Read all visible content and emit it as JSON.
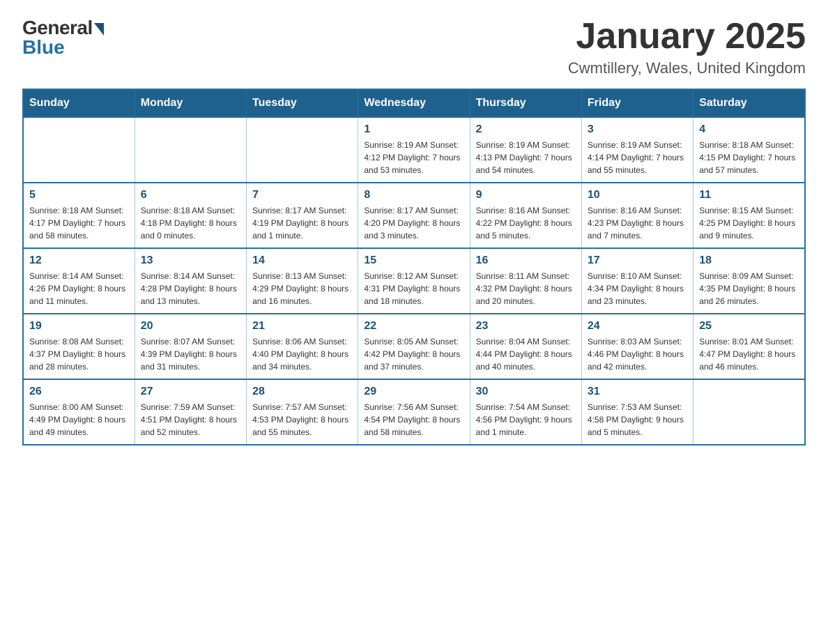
{
  "header": {
    "logo": {
      "general": "General",
      "blue": "Blue"
    },
    "title": "January 2025",
    "location": "Cwmtillery, Wales, United Kingdom"
  },
  "days_of_week": [
    "Sunday",
    "Monday",
    "Tuesday",
    "Wednesday",
    "Thursday",
    "Friday",
    "Saturday"
  ],
  "weeks": [
    [
      {
        "day": "",
        "info": ""
      },
      {
        "day": "",
        "info": ""
      },
      {
        "day": "",
        "info": ""
      },
      {
        "day": "1",
        "info": "Sunrise: 8:19 AM\nSunset: 4:12 PM\nDaylight: 7 hours\nand 53 minutes."
      },
      {
        "day": "2",
        "info": "Sunrise: 8:19 AM\nSunset: 4:13 PM\nDaylight: 7 hours\nand 54 minutes."
      },
      {
        "day": "3",
        "info": "Sunrise: 8:19 AM\nSunset: 4:14 PM\nDaylight: 7 hours\nand 55 minutes."
      },
      {
        "day": "4",
        "info": "Sunrise: 8:18 AM\nSunset: 4:15 PM\nDaylight: 7 hours\nand 57 minutes."
      }
    ],
    [
      {
        "day": "5",
        "info": "Sunrise: 8:18 AM\nSunset: 4:17 PM\nDaylight: 7 hours\nand 58 minutes."
      },
      {
        "day": "6",
        "info": "Sunrise: 8:18 AM\nSunset: 4:18 PM\nDaylight: 8 hours\nand 0 minutes."
      },
      {
        "day": "7",
        "info": "Sunrise: 8:17 AM\nSunset: 4:19 PM\nDaylight: 8 hours\nand 1 minute."
      },
      {
        "day": "8",
        "info": "Sunrise: 8:17 AM\nSunset: 4:20 PM\nDaylight: 8 hours\nand 3 minutes."
      },
      {
        "day": "9",
        "info": "Sunrise: 8:16 AM\nSunset: 4:22 PM\nDaylight: 8 hours\nand 5 minutes."
      },
      {
        "day": "10",
        "info": "Sunrise: 8:16 AM\nSunset: 4:23 PM\nDaylight: 8 hours\nand 7 minutes."
      },
      {
        "day": "11",
        "info": "Sunrise: 8:15 AM\nSunset: 4:25 PM\nDaylight: 8 hours\nand 9 minutes."
      }
    ],
    [
      {
        "day": "12",
        "info": "Sunrise: 8:14 AM\nSunset: 4:26 PM\nDaylight: 8 hours\nand 11 minutes."
      },
      {
        "day": "13",
        "info": "Sunrise: 8:14 AM\nSunset: 4:28 PM\nDaylight: 8 hours\nand 13 minutes."
      },
      {
        "day": "14",
        "info": "Sunrise: 8:13 AM\nSunset: 4:29 PM\nDaylight: 8 hours\nand 16 minutes."
      },
      {
        "day": "15",
        "info": "Sunrise: 8:12 AM\nSunset: 4:31 PM\nDaylight: 8 hours\nand 18 minutes."
      },
      {
        "day": "16",
        "info": "Sunrise: 8:11 AM\nSunset: 4:32 PM\nDaylight: 8 hours\nand 20 minutes."
      },
      {
        "day": "17",
        "info": "Sunrise: 8:10 AM\nSunset: 4:34 PM\nDaylight: 8 hours\nand 23 minutes."
      },
      {
        "day": "18",
        "info": "Sunrise: 8:09 AM\nSunset: 4:35 PM\nDaylight: 8 hours\nand 26 minutes."
      }
    ],
    [
      {
        "day": "19",
        "info": "Sunrise: 8:08 AM\nSunset: 4:37 PM\nDaylight: 8 hours\nand 28 minutes."
      },
      {
        "day": "20",
        "info": "Sunrise: 8:07 AM\nSunset: 4:39 PM\nDaylight: 8 hours\nand 31 minutes."
      },
      {
        "day": "21",
        "info": "Sunrise: 8:06 AM\nSunset: 4:40 PM\nDaylight: 8 hours\nand 34 minutes."
      },
      {
        "day": "22",
        "info": "Sunrise: 8:05 AM\nSunset: 4:42 PM\nDaylight: 8 hours\nand 37 minutes."
      },
      {
        "day": "23",
        "info": "Sunrise: 8:04 AM\nSunset: 4:44 PM\nDaylight: 8 hours\nand 40 minutes."
      },
      {
        "day": "24",
        "info": "Sunrise: 8:03 AM\nSunset: 4:46 PM\nDaylight: 8 hours\nand 42 minutes."
      },
      {
        "day": "25",
        "info": "Sunrise: 8:01 AM\nSunset: 4:47 PM\nDaylight: 8 hours\nand 46 minutes."
      }
    ],
    [
      {
        "day": "26",
        "info": "Sunrise: 8:00 AM\nSunset: 4:49 PM\nDaylight: 8 hours\nand 49 minutes."
      },
      {
        "day": "27",
        "info": "Sunrise: 7:59 AM\nSunset: 4:51 PM\nDaylight: 8 hours\nand 52 minutes."
      },
      {
        "day": "28",
        "info": "Sunrise: 7:57 AM\nSunset: 4:53 PM\nDaylight: 8 hours\nand 55 minutes."
      },
      {
        "day": "29",
        "info": "Sunrise: 7:56 AM\nSunset: 4:54 PM\nDaylight: 8 hours\nand 58 minutes."
      },
      {
        "day": "30",
        "info": "Sunrise: 7:54 AM\nSunset: 4:56 PM\nDaylight: 9 hours\nand 1 minute."
      },
      {
        "day": "31",
        "info": "Sunrise: 7:53 AM\nSunset: 4:58 PM\nDaylight: 9 hours\nand 5 minutes."
      },
      {
        "day": "",
        "info": ""
      }
    ]
  ]
}
